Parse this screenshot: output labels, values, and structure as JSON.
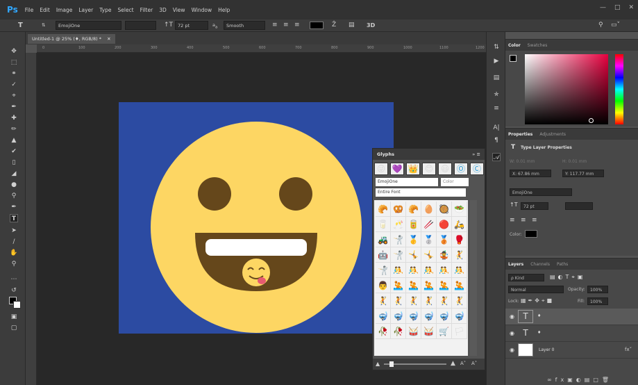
{
  "app": {
    "logo": "Ps",
    "name": "Photoshop"
  },
  "menu": [
    "File",
    "Edit",
    "Image",
    "Layer",
    "Type",
    "Select",
    "Filter",
    "3D",
    "View",
    "Window",
    "Help"
  ],
  "window_controls": [
    "minimize-icon",
    "maximize-icon",
    "close-icon"
  ],
  "options_bar": {
    "font_family": "EmojiOne",
    "font_size": "72 pt",
    "antialias": "Smooth",
    "tool_icon": "T"
  },
  "document": {
    "tab_label": "Untitled-1 @ 25% (♦, RGB/8) *",
    "ruler_labels": [
      "0",
      "50",
      "100",
      "150",
      "200",
      "250",
      "300",
      "350",
      "400",
      "450",
      "500",
      "550",
      "600",
      "650",
      "700",
      "750",
      "800",
      "850",
      "900",
      "950",
      "1000",
      "1050",
      "1100",
      "1150",
      "1200"
    ],
    "canvas_bg": "#2c4ba2",
    "emoji_face": "#fdd663",
    "emoji_dark": "#65471b"
  },
  "right_panels": {
    "color": {
      "tabs": [
        "Color",
        "Swatches"
      ]
    },
    "properties": {
      "tabs": [
        "Properties",
        "Adjustments"
      ],
      "title": "Type Layer Properties",
      "w": "W: 0.01 mm",
      "h": "H: 0.01 mm",
      "x": "X: 67.86 mm",
      "y": "Y: 117.77 mm",
      "font": "EmojiOne",
      "size": "72 pt",
      "color_label": "Color:"
    },
    "layers": {
      "tabs": [
        "Layers",
        "Channels",
        "Paths"
      ],
      "kind": "ρ Kind",
      "blend": "Normal",
      "opacity_label": "Opacity:",
      "opacity": "100%",
      "lock_label": "Lock:",
      "fill_label": "Fill:",
      "fill": "100%",
      "items": [
        {
          "thumb": "T",
          "name": "♦"
        },
        {
          "thumb": "T",
          "name": "♦"
        },
        {
          "thumb": "",
          "name": "Layer 0"
        }
      ]
    }
  },
  "glyphs": {
    "title": "Glyphs",
    "font": "EmojiOne",
    "color_field": "Color",
    "show": "Entire Font",
    "recent": [
      "😜",
      "💜",
      "👑",
      "😊",
      "😃",
      "Ⓞ",
      "Ⓒ"
    ],
    "grid": [
      "🥐",
      "🥨",
      "🥐",
      "🥚",
      "🥘",
      "🥗",
      "🥛",
      "🥂",
      "🥫",
      "🥢",
      "🔴",
      "🛵",
      "🚜",
      "🤺",
      "🥇",
      "🥈",
      "🥉",
      "🥊",
      "🤖",
      "🤺",
      "🤸",
      "🤸",
      "🤹",
      "🤾",
      "🤺",
      "🤼",
      "🤼",
      "🤼",
      "🤼",
      "🤼",
      "👨",
      "🤽",
      "🤽",
      "🤽",
      "🤽",
      "🤽",
      "🤾",
      "🤾",
      "🤾",
      "🤾",
      "🤾",
      "🤾",
      "🤿",
      "🤿",
      "🤿",
      "🤿",
      "🤿",
      "🤿",
      "🥀",
      "🥀",
      "🥁",
      "🥁",
      "🛒",
      "🏳"
    ]
  },
  "colors": {
    "ui_dark": "#323232",
    "panel": "#484848",
    "accent": "#31a8ff"
  }
}
